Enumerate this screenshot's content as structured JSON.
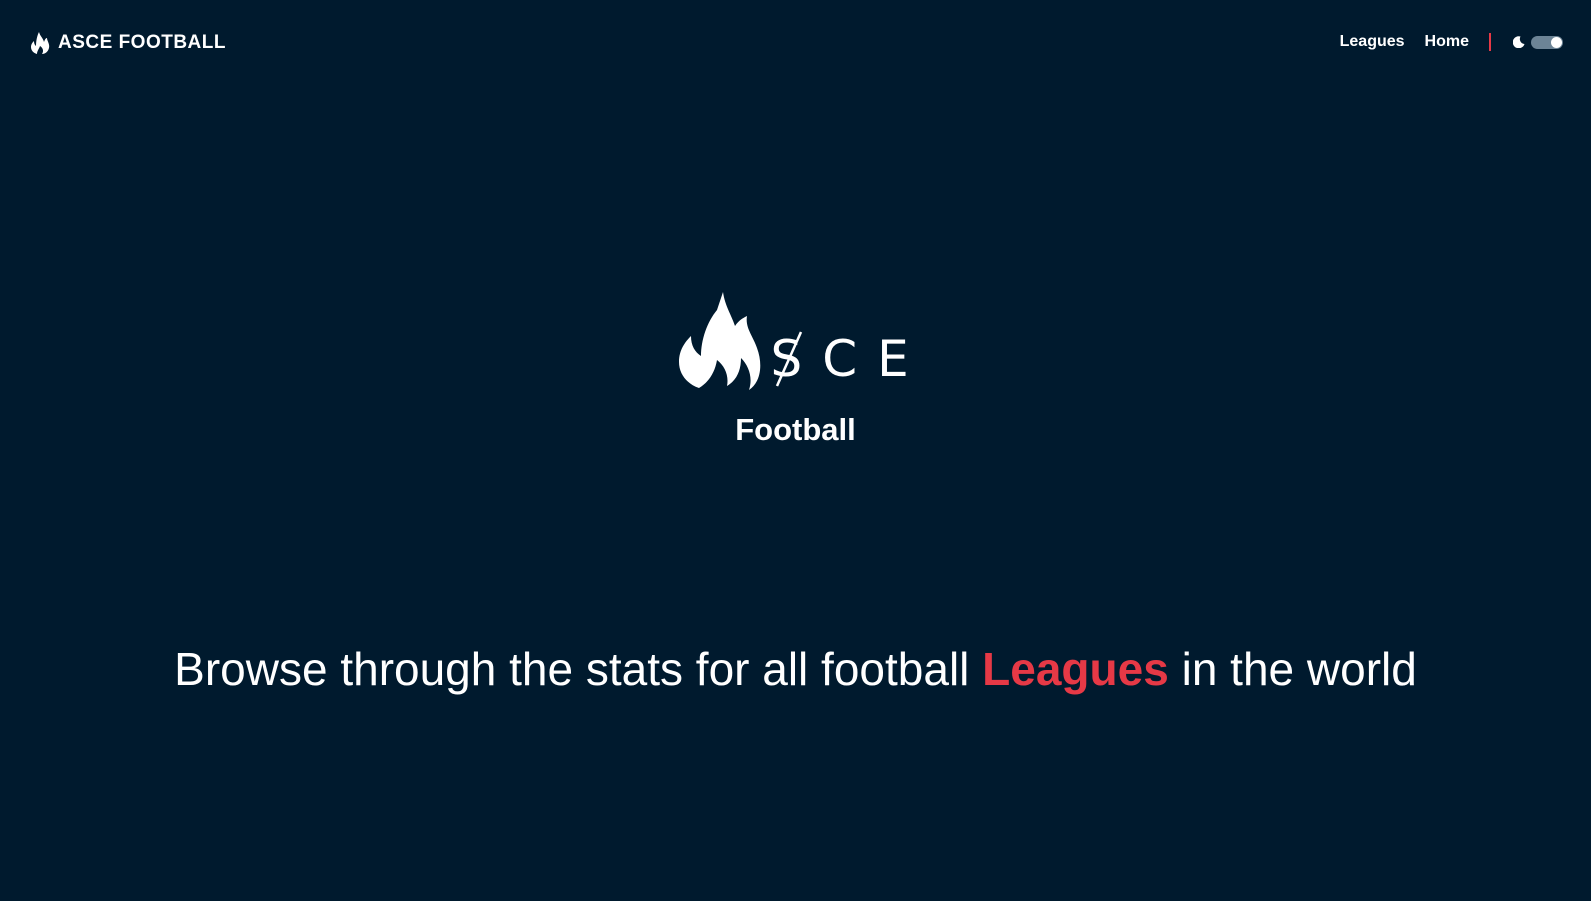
{
  "header": {
    "brand_label": "ASCE FOOTBALL",
    "brand_icon": "flame-icon",
    "nav": [
      {
        "label": "Leagues"
      },
      {
        "label": "Home"
      }
    ],
    "theme_toggle": {
      "icon": "moon-icon",
      "state": "on"
    }
  },
  "hero": {
    "logo_letters": [
      "S",
      "C",
      "E"
    ],
    "logo_icon": "flame-icon",
    "subtitle": "Football"
  },
  "tagline": {
    "before": "Browse through the stats for all football ",
    "highlight": "Leagues",
    "after": " in the world"
  },
  "colors": {
    "background": "#001a2e",
    "accent": "#e63946",
    "text": "#ffffff"
  }
}
